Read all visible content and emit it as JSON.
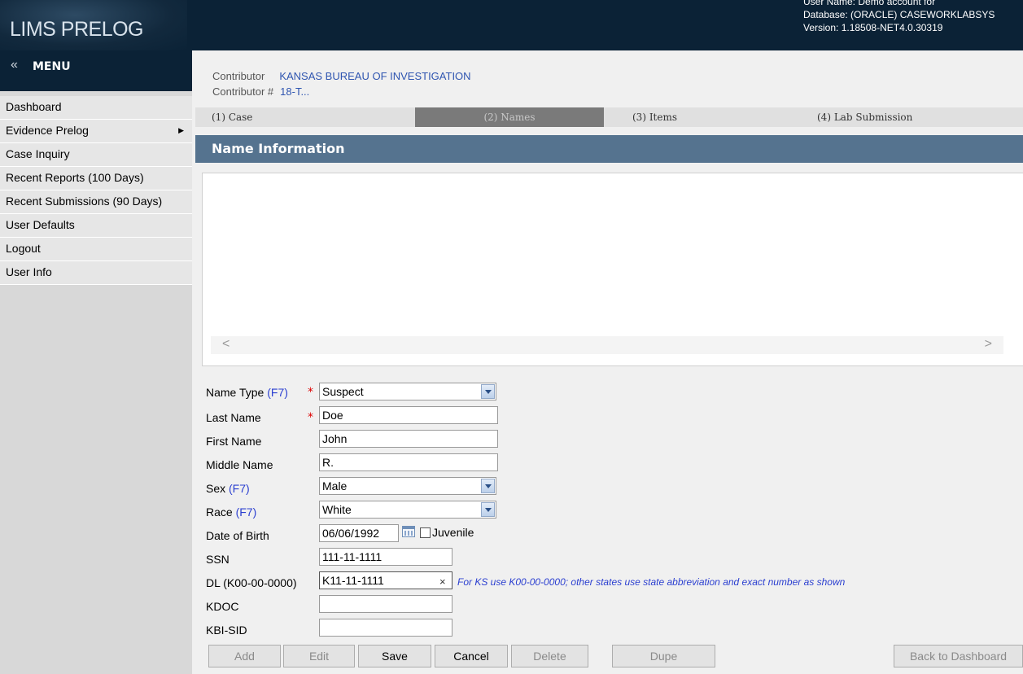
{
  "header": {
    "logo": "LIMS PRELOG",
    "user_name": "User Name: Demo account for",
    "database": "Database: (ORACLE) CASEWORKLABSYS",
    "version": "Version: 1.18508-NET4.0.30319"
  },
  "menu": {
    "collapse": "«",
    "title": "MENU",
    "items": [
      {
        "label": "Dashboard"
      },
      {
        "label": "Evidence Prelog",
        "has_submenu": true
      },
      {
        "label": "Case Inquiry"
      },
      {
        "label": "Recent Reports (100 Days)"
      },
      {
        "label": "Recent Submissions (90 Days)"
      },
      {
        "label": "User Defaults"
      },
      {
        "label": "Logout"
      },
      {
        "label": "User Info"
      }
    ]
  },
  "contributor": {
    "label": "Contributor",
    "value": "KANSAS BUREAU OF INVESTIGATION",
    "number_label": "Contributor #",
    "number_value": "18-T..."
  },
  "tabs": [
    {
      "label": "(1) Case",
      "active": false
    },
    {
      "label": "(2) Names",
      "active": true
    },
    {
      "label": "(3) Items",
      "active": false
    },
    {
      "label": "(4) Lab Submission",
      "active": false
    }
  ],
  "section_title": "Name Information",
  "grid": {
    "scroll_left": "<",
    "scroll_right": ">"
  },
  "form": {
    "name_type": {
      "label": "Name Type",
      "hotkey": "(F7)",
      "value": "Suspect",
      "required": "*"
    },
    "last_name": {
      "label": "Last Name",
      "value": "Doe",
      "required": "*"
    },
    "first_name": {
      "label": "First Name",
      "value": "John"
    },
    "middle_name": {
      "label": "Middle Name",
      "value": "R."
    },
    "sex": {
      "label": "Sex",
      "hotkey": "(F7)",
      "value": "Male"
    },
    "race": {
      "label": "Race",
      "hotkey": "(F7)",
      "value": "White"
    },
    "dob": {
      "label": "Date of Birth",
      "value": "06/06/1992",
      "juvenile_label": "Juvenile"
    },
    "ssn": {
      "label": "SSN",
      "value": "111-11-1111"
    },
    "dl": {
      "label": "DL (K00-00-0000)",
      "value": "K11-11-1111",
      "clear": "×",
      "hint": "For KS use K00-00-0000; other states use state abbreviation and exact number as shown"
    },
    "kdoc": {
      "label": "KDOC",
      "value": ""
    },
    "kbi_sid": {
      "label": "KBI-SID",
      "value": ""
    }
  },
  "buttons": {
    "add": "Add",
    "edit": "Edit",
    "save": "Save",
    "cancel": "Cancel",
    "delete": "Delete",
    "dupe": "Dupe",
    "back": "Back to Dashboard"
  },
  "colors": {
    "header_bg": "#0b2236",
    "section_bg": "#55738f",
    "hotkey": "#2b3fd0",
    "required": "#dd0000"
  }
}
